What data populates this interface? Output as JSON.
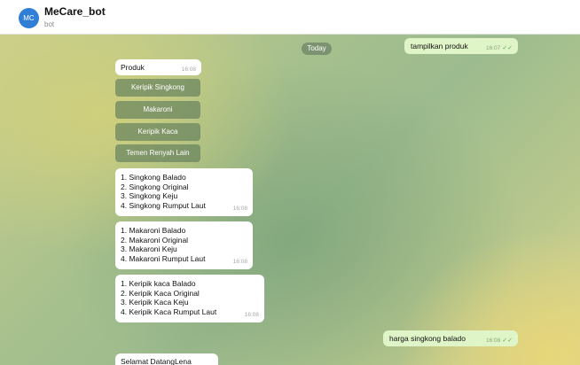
{
  "header": {
    "title": "MeCare_bot",
    "subtitle": "bot",
    "avatar_label": "MC"
  },
  "chat": {
    "date_badge": "Today",
    "messages": {
      "m1": {
        "text": "tampilkan produk",
        "time": "16:07"
      },
      "m2": {
        "text": "Produk",
        "time": "16:08"
      },
      "m3": {
        "lines": [
          "1. Singkong Balado",
          "2. Singkong Original",
          "3. Singkong Keju",
          "4. Singkong Rumput Laut"
        ],
        "time": "16:08"
      },
      "m4": {
        "lines": [
          "1. Makaroni Balado",
          "2. Makaroni Original",
          "3. Makaroni Keju",
          "4. Makaroni Rumput Laut"
        ],
        "time": "16:08"
      },
      "m5": {
        "lines": [
          "1. Keripik kaca Balado",
          "2. Keripik Kaca Original",
          "3. Keripik Kaca Keju",
          "4. Keripik Kaca Rumput Laut"
        ],
        "time": "16:08"
      },
      "m6": {
        "text": "harga singkong balado",
        "time": "16:08"
      },
      "m7": {
        "text": "Selamat DatangLena"
      }
    },
    "keyboard_buttons": [
      "Keripik Singkong",
      "Makaroni",
      "Keripik Kaca",
      "Temen Renyah Lain"
    ]
  },
  "icons": {
    "read_check": "double-check-icon"
  }
}
